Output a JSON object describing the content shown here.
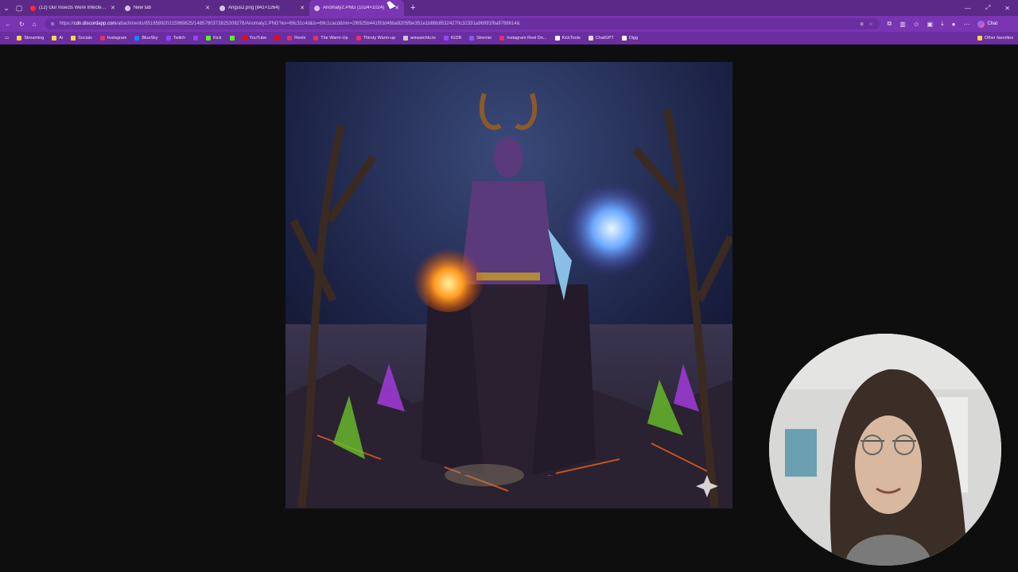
{
  "tabs": [
    {
      "title": "(12) Our Insects Were Infected wit",
      "favicon_color": "#ff2a2a",
      "active": false
    },
    {
      "title": "New tab",
      "favicon_color": "#d6c4e8",
      "active": false
    },
    {
      "title": "Angus2.png (841×1264)",
      "favicon_color": "#d6c4e8",
      "active": false
    },
    {
      "title": "Anomaly2.PNG (1024×1024)",
      "favicon_color": "#d6c4e8",
      "active": true
    }
  ],
  "address": {
    "scheme": "https://",
    "host": "cdn.discordapp.com",
    "path": "/attachments/851658920215969825/1485780372825309276/Anomaly2.PNG?ex=69c31c4d&is=69c1cacd&hm=2f6925b441f93d46ba9205fbe351e1b86b85324270c32331a96991f8a9788614&"
  },
  "chat_label": "Chat",
  "bookmarks": [
    {
      "label": "Streaming",
      "color": "#ffd54a"
    },
    {
      "label": "Ai",
      "color": "#ffd54a"
    },
    {
      "label": "Socials",
      "color": "#ffd54a"
    },
    {
      "label": "Instagram",
      "color": "#e1306c"
    },
    {
      "label": "BlueSky",
      "color": "#1185fe"
    },
    {
      "label": "Twitch",
      "color": "#9146ff"
    },
    {
      "label": "",
      "color": "#9146ff"
    },
    {
      "label": "Kick",
      "color": "#53fc18"
    },
    {
      "label": "",
      "color": "#53fc18"
    },
    {
      "label": "YouTube",
      "color": "#ff0000"
    },
    {
      "label": "",
      "color": "#ff0000"
    },
    {
      "label": "Reels",
      "color": "#e1306c"
    },
    {
      "label": "The Warm-Up",
      "color": "#e1306c"
    },
    {
      "label": "Thirsty Warm-up",
      "color": "#e1306c"
    },
    {
      "label": "aniwatchtv.to",
      "color": "#cccccc"
    },
    {
      "label": "IGDB",
      "color": "#9147ff"
    },
    {
      "label": "Stremio",
      "color": "#7b5bf5"
    },
    {
      "label": "Instagram Reel Do...",
      "color": "#e1306c"
    },
    {
      "label": "KickTools",
      "color": "#ffffff"
    },
    {
      "label": "ChatGPT",
      "color": "#dddddd"
    },
    {
      "label": "Digg",
      "color": "#ffffff"
    }
  ],
  "other_favorites": "Other favorites"
}
